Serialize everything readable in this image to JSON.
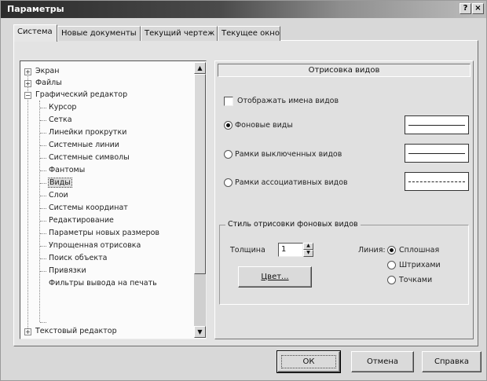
{
  "window": {
    "title": "Параметры",
    "help_label": "?",
    "close_label": "×"
  },
  "tabs": [
    {
      "label": "Система"
    },
    {
      "label": "Новые документы"
    },
    {
      "label": "Текущий чертеж"
    },
    {
      "label": "Текущее окно"
    }
  ],
  "tree": {
    "items": [
      {
        "label": "Экран",
        "expander": "+"
      },
      {
        "label": "Файлы",
        "expander": "+"
      },
      {
        "label": "Графический редактор",
        "expander": "−"
      },
      {
        "label": "Курсор"
      },
      {
        "label": "Сетка"
      },
      {
        "label": "Линейки прокрутки"
      },
      {
        "label": "Системные линии"
      },
      {
        "label": "Системные символы"
      },
      {
        "label": "Фантомы"
      },
      {
        "label": "Виды"
      },
      {
        "label": "Слои"
      },
      {
        "label": "Системы координат"
      },
      {
        "label": "Редактирование"
      },
      {
        "label": "Параметры новых размеров"
      },
      {
        "label": "Упрощенная отрисовка"
      },
      {
        "label": "Поиск объекта"
      },
      {
        "label": "Привязки"
      },
      {
        "label": "Фильтры вывода на печать"
      },
      {
        "label": "Текстовый редактор",
        "expander": "+"
      }
    ],
    "selected": "Виды"
  },
  "panel": {
    "header": "Отрисовка видов",
    "show_names_label": "Отображать имена видов",
    "options": [
      {
        "label": "Фоновые виды",
        "checked": true,
        "line_style": "solid"
      },
      {
        "label": "Рамки выключенных видов",
        "checked": false,
        "line_style": "solid"
      },
      {
        "label": "Рамки ассоциативных видов",
        "checked": false,
        "line_style": "dotted"
      }
    ],
    "group": {
      "title": "Стиль отрисовки фоновых видов",
      "thickness_label": "Толщина",
      "thickness_value": "1",
      "line_label": "Линия:",
      "line_options": [
        {
          "label": "Сплошная",
          "checked": true
        },
        {
          "label": "Штрихами",
          "checked": false
        },
        {
          "label": "Точками",
          "checked": false
        }
      ],
      "color_button": "Цвет..."
    }
  },
  "footer": {
    "ok": "ОК",
    "cancel": "Отмена",
    "help": "Справка"
  }
}
